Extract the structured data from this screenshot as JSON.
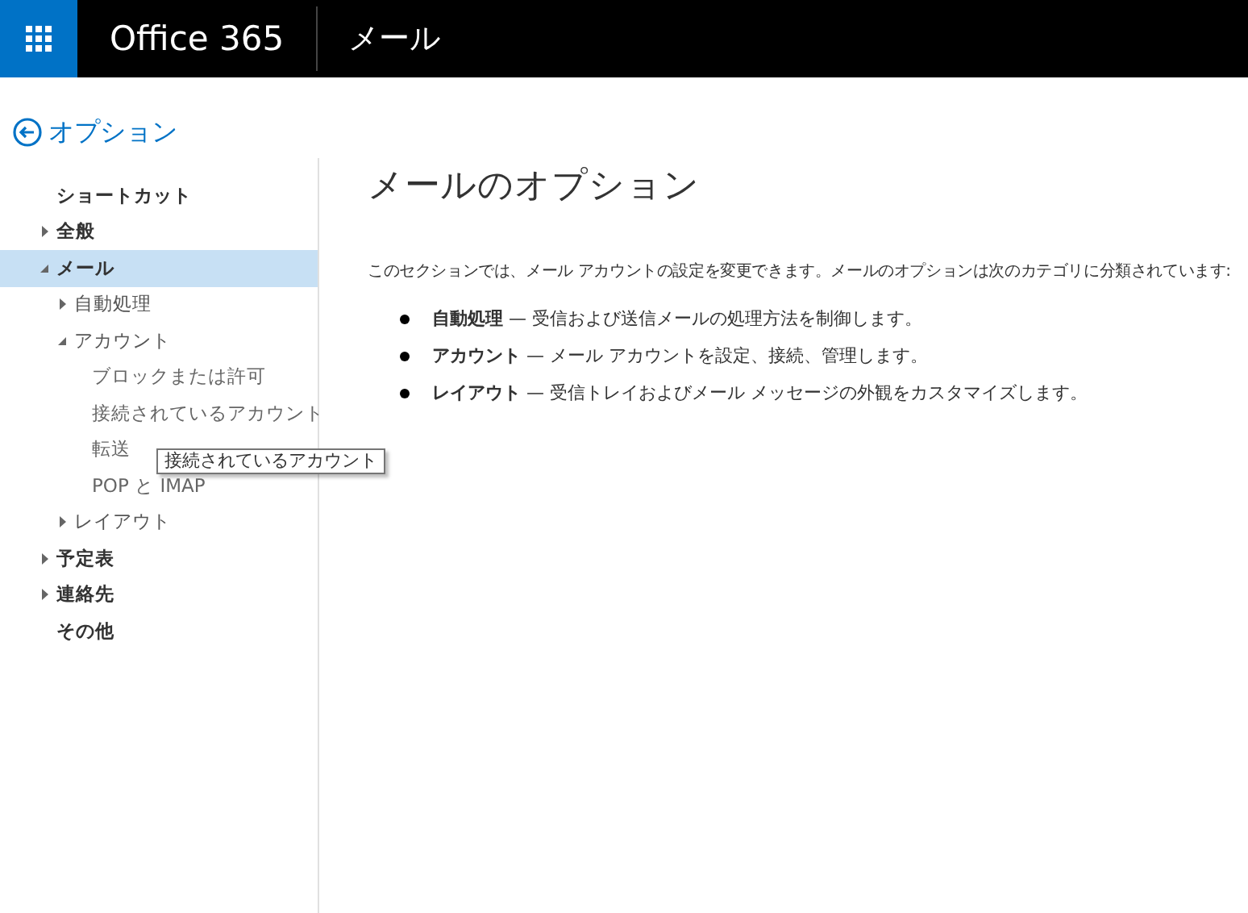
{
  "header": {
    "brand": "Office 365",
    "app": "メール"
  },
  "back": {
    "label": "オプション"
  },
  "nav": [
    {
      "label": "ショートカット",
      "selected": false
    },
    {
      "label": "全般",
      "selected": false,
      "expanded": false
    },
    {
      "label": "メール",
      "selected": true,
      "expanded": true,
      "children": [
        {
          "label": "自動処理",
          "selected": false,
          "expanded": false
        },
        {
          "label": "アカウント",
          "selected": false,
          "expanded": true,
          "children": [
            {
              "label": "ブロックまたは許可",
              "selected": false
            },
            {
              "label": "接続されているアカウント",
              "selected": false
            },
            {
              "label": "転送",
              "selected": false
            },
            {
              "label": "POP と IMAP",
              "selected": false
            }
          ]
        },
        {
          "label": "レイアウト",
          "selected": false,
          "expanded": false
        }
      ]
    },
    {
      "label": "予定表",
      "selected": false,
      "expanded": false
    },
    {
      "label": "連絡先",
      "selected": false,
      "expanded": false
    },
    {
      "label": "その他",
      "selected": false
    }
  ],
  "tooltip": "接続されているアカウント",
  "main": {
    "title": "メールのオプション",
    "intro": "このセクションでは、メール アカウントの設定を変更できます。メールのオプションは次のカテゴリに分類されています:",
    "bullets": [
      "**自動処理** — 受信および送信メールの処理方法を制御します。",
      "**アカウント** — メール アカウントを設定、接続、管理します。",
      "**レイアウト** — 受信トレイおよびメール メッセージの外観をカスタマイズします。"
    ]
  }
}
